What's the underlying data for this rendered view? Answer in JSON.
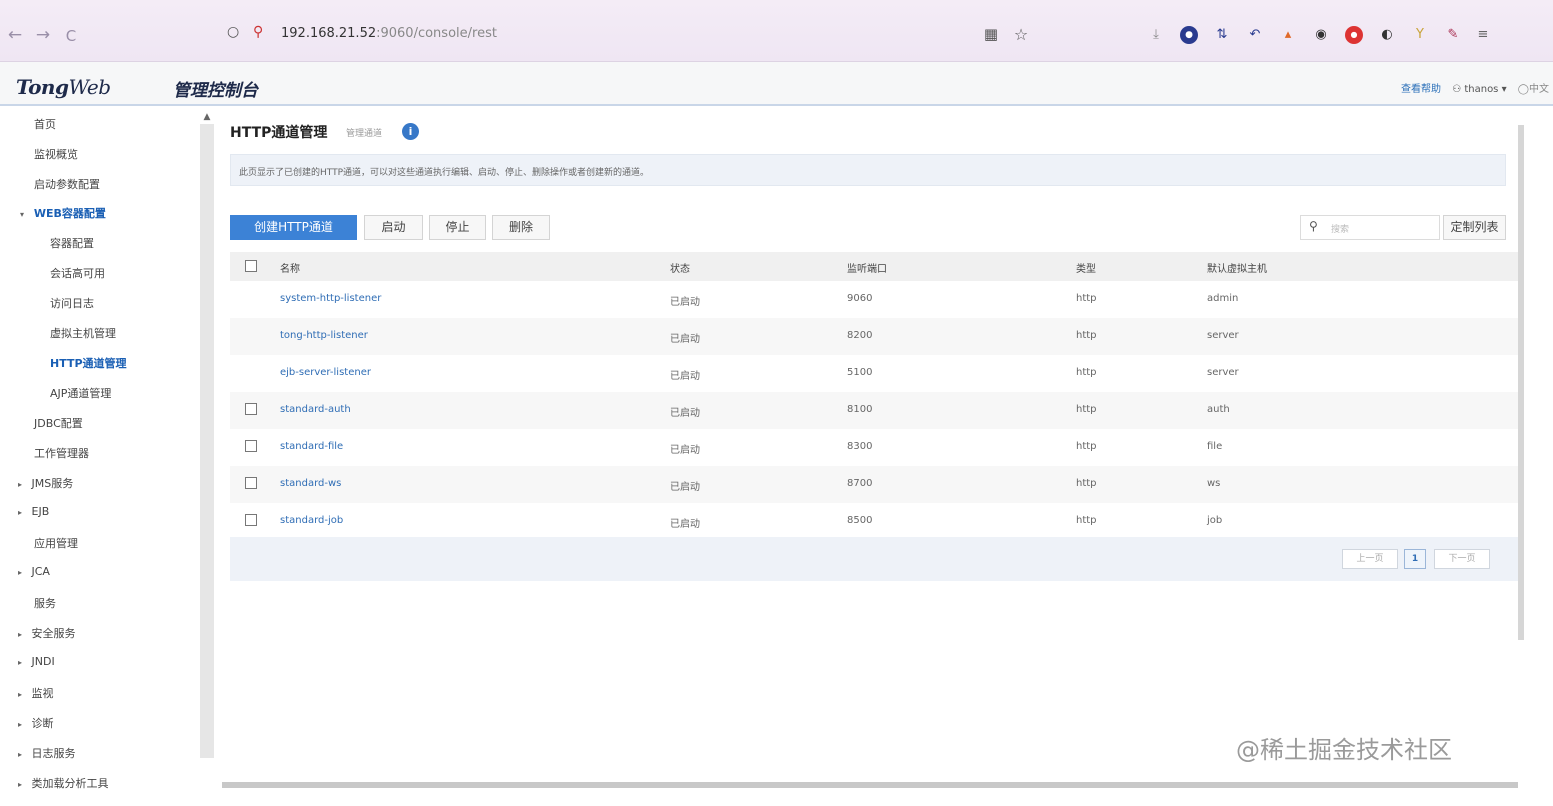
{
  "browser": {
    "back": "←",
    "forward": "→",
    "reload": "C",
    "url_host": "192.168.21.52",
    "url_rest": ":9060/console/rest",
    "qr_icon": "▦",
    "star_icon": "☆"
  },
  "header": {
    "logo_tong": "Tong",
    "logo_web": "Web",
    "console_title": "管理控制台",
    "help": "查看帮助",
    "user": "thanos",
    "lang": "中文"
  },
  "sidebar": {
    "items": [
      {
        "label": "首页",
        "arrow": ""
      },
      {
        "label": "监视概览",
        "arrow": ""
      },
      {
        "label": "启动参数配置",
        "arrow": ""
      },
      {
        "label": "WEB容器配置",
        "arrow": "▾"
      },
      {
        "label": "容器配置",
        "arrow": ""
      },
      {
        "label": "会话高可用",
        "arrow": ""
      },
      {
        "label": "访问日志",
        "arrow": ""
      },
      {
        "label": "虚拟主机管理",
        "arrow": ""
      },
      {
        "label": "HTTP通道管理",
        "arrow": ""
      },
      {
        "label": "AJP通道管理",
        "arrow": ""
      },
      {
        "label": "JDBC配置",
        "arrow": ""
      },
      {
        "label": "工作管理器",
        "arrow": ""
      },
      {
        "label": "JMS服务",
        "arrow": "▸"
      },
      {
        "label": "EJB",
        "arrow": "▸"
      },
      {
        "label": "应用管理",
        "arrow": ""
      },
      {
        "label": "JCA",
        "arrow": "▸"
      },
      {
        "label": "服务",
        "arrow": ""
      },
      {
        "label": "安全服务",
        "arrow": "▸"
      },
      {
        "label": "JNDI",
        "arrow": "▸"
      },
      {
        "label": "监视",
        "arrow": "▸"
      },
      {
        "label": "诊断",
        "arrow": "▸"
      },
      {
        "label": "日志服务",
        "arrow": "▸"
      },
      {
        "label": "类加载分析工具",
        "arrow": "▸"
      }
    ]
  },
  "main": {
    "title": "HTTP通道管理",
    "subtitle": "管理通道",
    "info": "i",
    "description": "此页显示了已创建的HTTP通道，可以对这些通道执行编辑、启动、停止、删除操作或者创建新的通道。",
    "buttons": {
      "create": "创建HTTP通道",
      "start": "启动",
      "stop": "停止",
      "delete": "删除",
      "customize": "定制列表"
    },
    "search_placeholder": "搜索",
    "columns": [
      "名称",
      "状态",
      "监听端口",
      "类型",
      "默认虚拟主机"
    ],
    "rows": [
      {
        "name": "system-http-listener",
        "status": "已启动",
        "port": "9060",
        "type": "http",
        "host": "admin",
        "checkbox": false
      },
      {
        "name": "tong-http-listener",
        "status": "已启动",
        "port": "8200",
        "type": "http",
        "host": "server",
        "checkbox": false
      },
      {
        "name": "ejb-server-listener",
        "status": "已启动",
        "port": "5100",
        "type": "http",
        "host": "server",
        "checkbox": false
      },
      {
        "name": "standard-auth",
        "status": "已启动",
        "port": "8100",
        "type": "http",
        "host": "auth",
        "checkbox": true
      },
      {
        "name": "standard-file",
        "status": "已启动",
        "port": "8300",
        "type": "http",
        "host": "file",
        "checkbox": true
      },
      {
        "name": "standard-ws",
        "status": "已启动",
        "port": "8700",
        "type": "http",
        "host": "ws",
        "checkbox": true
      },
      {
        "name": "standard-job",
        "status": "已启动",
        "port": "8500",
        "type": "http",
        "host": "job",
        "checkbox": true
      }
    ],
    "pager": {
      "prev": "上一页",
      "current": "1",
      "next": "下一页"
    }
  },
  "watermark": "@稀土掘金技术社区",
  "colors": {
    "accent": "#3c82d6",
    "link": "#2f6db5",
    "active_nav": "#1a5fb4"
  }
}
